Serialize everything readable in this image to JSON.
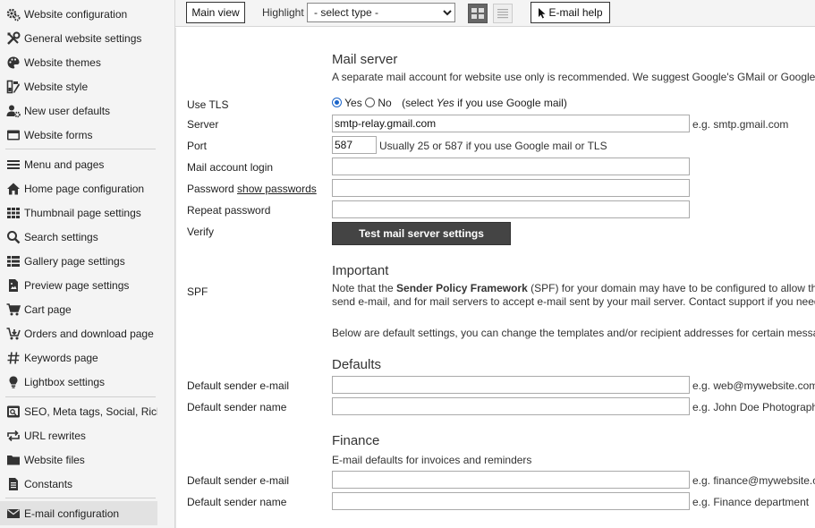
{
  "sidebar": {
    "items": [
      {
        "label": "Website configuration",
        "icon": "gears-icon"
      },
      {
        "label": "General website settings",
        "icon": "tools-icon"
      },
      {
        "label": "Website themes",
        "icon": "palette-icon"
      },
      {
        "label": "Website style",
        "icon": "style-icon"
      },
      {
        "label": "New user defaults",
        "icon": "user-gear-icon"
      },
      {
        "label": "Website forms",
        "icon": "form-icon"
      },
      {
        "label": "Menu and pages",
        "icon": "menu-icon"
      },
      {
        "label": "Home page configuration",
        "icon": "home-icon"
      },
      {
        "label": "Thumbnail page settings",
        "icon": "grid-icon"
      },
      {
        "label": "Search settings",
        "icon": "search-icon"
      },
      {
        "label": "Gallery page settings",
        "icon": "list-grid-icon"
      },
      {
        "label": "Preview page settings",
        "icon": "image-file-icon"
      },
      {
        "label": "Cart page",
        "icon": "cart-icon"
      },
      {
        "label": "Orders and download page",
        "icon": "cart-download-icon"
      },
      {
        "label": "Keywords page",
        "icon": "hashtag-icon"
      },
      {
        "label": "Lightbox settings",
        "icon": "lightbulb-icon"
      },
      {
        "label": "SEO, Meta tags, Social, Rich r...",
        "icon": "seo-icon"
      },
      {
        "label": "URL rewrites",
        "icon": "rewrite-icon"
      },
      {
        "label": "Website files",
        "icon": "folder-icon"
      },
      {
        "label": "Constants",
        "icon": "document-icon"
      },
      {
        "label": "E-mail configuration",
        "icon": "envelope-icon"
      }
    ]
  },
  "toolbar": {
    "main_view": "Main view",
    "highlight_label": "Highlight",
    "highlight_selected": "- select type -",
    "email_help": "E-mail help"
  },
  "mail_server": {
    "title": "Mail server",
    "intro": "A separate mail account for website use only is recommended. We suggest Google's GMail or Google for c",
    "use_tls_label": "Use TLS",
    "tls_yes": "Yes",
    "tls_no": "No",
    "tls_note_prefix": "(select ",
    "tls_note_em": "Yes",
    "tls_note_suffix": " if you use Google mail)",
    "server_label": "Server",
    "server_value": "smtp-relay.gmail.com",
    "server_hint": "e.g. smtp.gmail.com",
    "port_label": "Port",
    "port_value": "587",
    "port_hint": "Usually 25 or 587 if you use Google mail or TLS",
    "login_label": "Mail account login",
    "password_label": "Password",
    "show_passwords": "show passwords",
    "repeat_password_label": "Repeat password",
    "verify_label": "Verify",
    "test_button": "Test mail server settings"
  },
  "important": {
    "title": "Important",
    "spf_label": "SPF",
    "spf_prefix": "Note that the ",
    "spf_bold": "Sender Policy Framework",
    "spf_line1_rest": " (SPF) for your domain may have to be configured to allow the web s",
    "spf_line2": "send e-mail, and for mail servers to accept e-mail sent by your mail server. Contact support if you need hel",
    "defaults_note": "Below are default settings, you can change the templates and/or recipient addresses for certain messages"
  },
  "defaults": {
    "title": "Defaults",
    "sender_email_label": "Default sender e-mail",
    "sender_email_hint": "e.g. web@mywebsite.com (",
    "sender_name_label": "Default sender name",
    "sender_name_hint": "e.g. John Doe Photography"
  },
  "finance": {
    "title": "Finance",
    "subtitle": "E-mail defaults for invoices and reminders",
    "sender_email_label": "Default sender e-mail",
    "sender_email_hint": "e.g. finance@mywebsite.co",
    "sender_name_label": "Default sender name",
    "sender_name_hint": "e.g. Finance department"
  }
}
